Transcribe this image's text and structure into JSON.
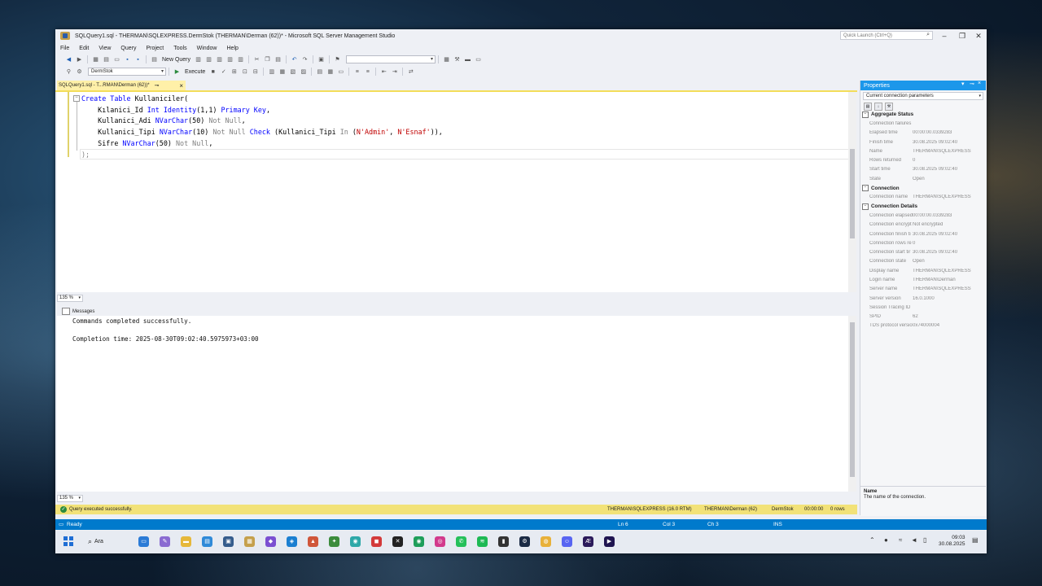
{
  "window": {
    "title": "SQLQuery1.sql - THERMAN\\SQLEXPRESS.DermStok (THERMAN\\Derman (62))* - Microsoft SQL Server Management Studio",
    "quick_launch_placeholder": "Quick Launch (Ctrl+Q)"
  },
  "menu": [
    "File",
    "Edit",
    "View",
    "Query",
    "Project",
    "Tools",
    "Window",
    "Help"
  ],
  "toolbar": {
    "new_query": "New Query",
    "database": "DermStok",
    "execute": "Execute"
  },
  "doc_tab": {
    "label": "SQLQuery1.sql - T...RMAN\\Derman (62))*"
  },
  "editor": {
    "zoom": "135 %",
    "lines": [
      [
        {
          "t": "Create Table ",
          "c": "kw"
        },
        {
          "t": "Kullaniciler(",
          "c": ""
        }
      ],
      [
        {
          "t": "    Kılanici_Id ",
          "c": ""
        },
        {
          "t": "Int Identity",
          "c": "kw"
        },
        {
          "t": "(1,1) ",
          "c": ""
        },
        {
          "t": "Primary Key",
          "c": "kw"
        },
        {
          "t": ",",
          "c": ""
        }
      ],
      [
        {
          "t": "    Kullanici_Adi ",
          "c": ""
        },
        {
          "t": "NVarChar",
          "c": "kw"
        },
        {
          "t": "(50) ",
          "c": ""
        },
        {
          "t": "Not Null",
          "c": "gr"
        },
        {
          "t": ",",
          "c": ""
        }
      ],
      [
        {
          "t": "    Kullanici_Tipi ",
          "c": ""
        },
        {
          "t": "NVarChar",
          "c": "kw"
        },
        {
          "t": "(10) ",
          "c": ""
        },
        {
          "t": "Not Null ",
          "c": "gr"
        },
        {
          "t": "Check ",
          "c": "kw"
        },
        {
          "t": "(Kullanici_Tipi ",
          "c": ""
        },
        {
          "t": "In ",
          "c": "gr"
        },
        {
          "t": "(",
          "c": ""
        },
        {
          "t": "N'Admin'",
          "c": "str"
        },
        {
          "t": ", ",
          "c": ""
        },
        {
          "t": "N'Esnaf'",
          "c": "str"
        },
        {
          "t": ")),",
          "c": ""
        }
      ],
      [
        {
          "t": "    Sifre ",
          "c": ""
        },
        {
          "t": "NVarChar",
          "c": "kw"
        },
        {
          "t": "(50) ",
          "c": ""
        },
        {
          "t": "Not Null",
          "c": "gr"
        },
        {
          "t": ",",
          "c": ""
        }
      ],
      [
        {
          "t": ");",
          "c": "gr"
        }
      ]
    ]
  },
  "results": {
    "tab": "Messages",
    "zoom": "135 %",
    "line1": "Commands completed successfully.",
    "line2": "Completion time: 2025-08-30T09:02:40.5975973+03:00"
  },
  "query_status": {
    "message": "Query executed successfully.",
    "server": "THERMAN\\SQLEXPRESS (16.0 RTM)",
    "user": "THERMAN\\Derman (62)",
    "db": "DermStok",
    "time": "00:00:00",
    "rows": "0 rows"
  },
  "properties": {
    "title": "Properties",
    "object": "Current connection parameters",
    "categories": [
      {
        "name": "Aggregate Status",
        "rows": [
          [
            "Connection failures",
            ""
          ],
          [
            "Elapsed time",
            "00:00:00.0339283"
          ],
          [
            "Finish time",
            "30.08.2025 09:02:40"
          ],
          [
            "Name",
            "THERMAN\\SQLEXPRESS"
          ],
          [
            "Rows returned",
            "0"
          ],
          [
            "Start time",
            "30.08.2025 09:02:40"
          ],
          [
            "State",
            "Open"
          ]
        ]
      },
      {
        "name": "Connection",
        "rows": [
          [
            "Connection name",
            "THERMAN\\SQLEXPRESS"
          ]
        ]
      },
      {
        "name": "Connection Details",
        "rows": [
          [
            "Connection elapsed",
            "00:00:00.0339283"
          ],
          [
            "Connection encrypt",
            "Not encrypted"
          ],
          [
            "Connection finish ti",
            "30.08.2025 09:02:40"
          ],
          [
            "Connection rows re",
            "0"
          ],
          [
            "Connection start tir",
            "30.08.2025 09:02:40"
          ],
          [
            "Connection state",
            "Open"
          ],
          [
            "Display name",
            "THERMAN\\SQLEXPRESS"
          ],
          [
            "Login name",
            "THERMAN\\Derman"
          ],
          [
            "Server name",
            "THERMAN\\SQLEXPRESS"
          ],
          [
            "Server version",
            "16.0.1000"
          ],
          [
            "Session Tracing ID",
            ""
          ],
          [
            "SPID",
            "62"
          ],
          [
            "TDS protocol versio",
            "0x74000004"
          ]
        ]
      }
    ],
    "desc_name": "Name",
    "desc_text": "The name of the connection."
  },
  "statusbar": {
    "ready": "Ready",
    "ln": "Ln 6",
    "col": "Col 3",
    "ch": "Ch 3",
    "ins": "INS"
  },
  "taskbar": {
    "search": "Ara",
    "time": "09:03",
    "date": "30.08.2025"
  }
}
